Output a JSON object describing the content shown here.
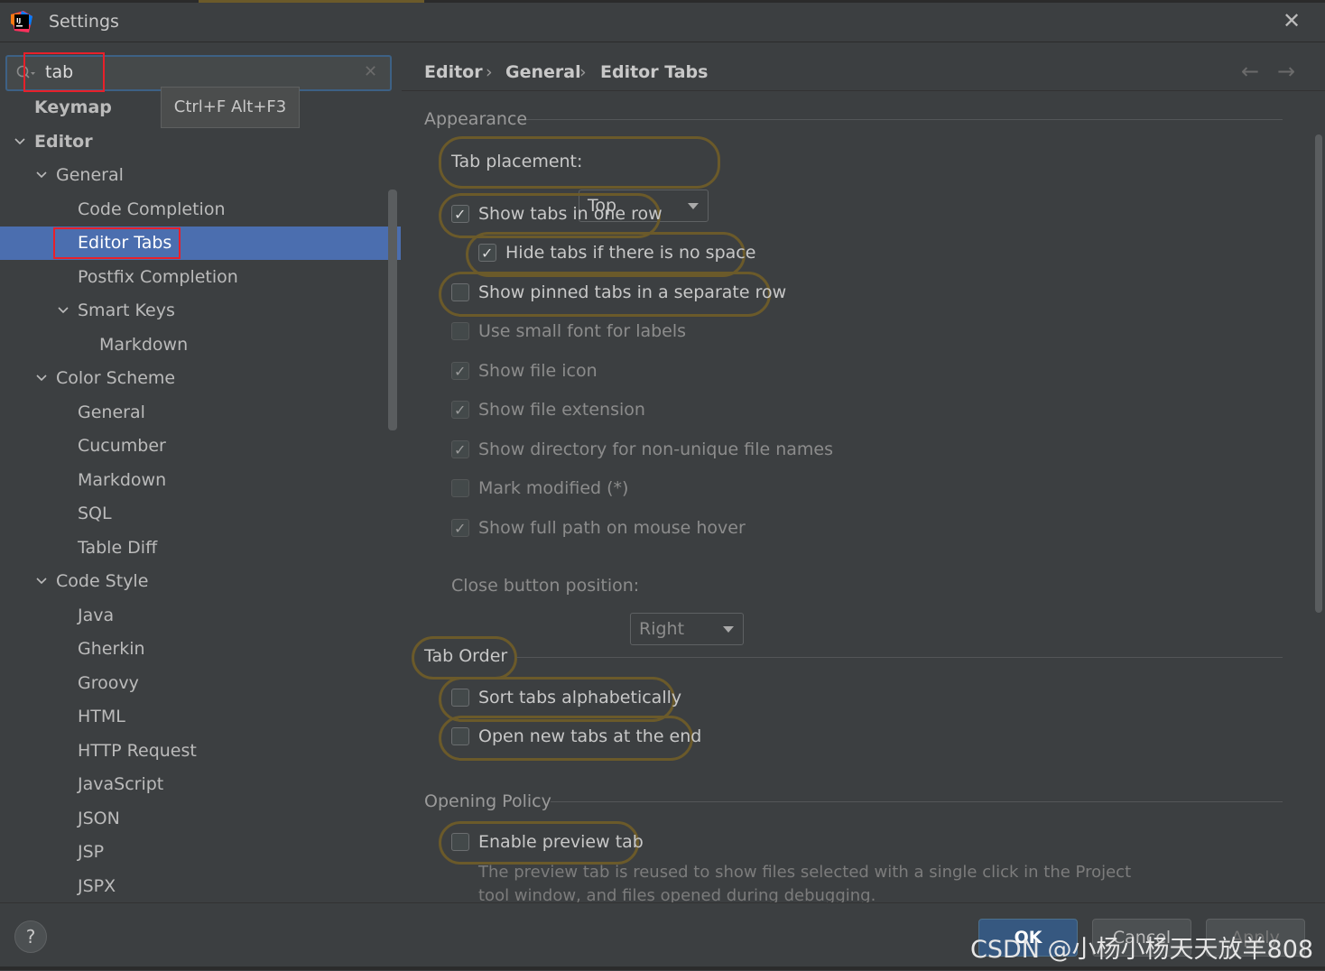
{
  "window": {
    "title": "Settings",
    "close_symbol": "✕"
  },
  "search": {
    "value": "tab",
    "clear_symbol": "✕",
    "tooltip": "Ctrl+F Alt+F3"
  },
  "tree": [
    {
      "label": "Keymap",
      "level": 0,
      "bold": true,
      "chevron": false
    },
    {
      "label": "Editor",
      "level": 0,
      "bold": true,
      "chevron": true
    },
    {
      "label": "General",
      "level": 1,
      "chevron": true
    },
    {
      "label": "Code Completion",
      "level": 2,
      "chevron": false
    },
    {
      "label": "Editor Tabs",
      "level": 2,
      "chevron": false,
      "selected": true
    },
    {
      "label": "Postfix Completion",
      "level": 2,
      "chevron": false
    },
    {
      "label": "Smart Keys",
      "level": 2,
      "chevron": true
    },
    {
      "label": "Markdown",
      "level": 3,
      "chevron": false
    },
    {
      "label": "Color Scheme",
      "level": 1,
      "chevron": true
    },
    {
      "label": "General",
      "level": 2,
      "chevron": false
    },
    {
      "label": "Cucumber",
      "level": 2,
      "chevron": false
    },
    {
      "label": "Markdown",
      "level": 2,
      "chevron": false
    },
    {
      "label": "SQL",
      "level": 2,
      "chevron": false
    },
    {
      "label": "Table Diff",
      "level": 2,
      "chevron": false
    },
    {
      "label": "Code Style",
      "level": 1,
      "chevron": true
    },
    {
      "label": "Java",
      "level": 2,
      "chevron": false
    },
    {
      "label": "Gherkin",
      "level": 2,
      "chevron": false
    },
    {
      "label": "Groovy",
      "level": 2,
      "chevron": false
    },
    {
      "label": "HTML",
      "level": 2,
      "chevron": false
    },
    {
      "label": "HTTP Request",
      "level": 2,
      "chevron": false
    },
    {
      "label": "JavaScript",
      "level": 2,
      "chevron": false
    },
    {
      "label": "JSON",
      "level": 2,
      "chevron": false
    },
    {
      "label": "JSP",
      "level": 2,
      "chevron": false
    },
    {
      "label": "JSPX",
      "level": 2,
      "chevron": false
    }
  ],
  "breadcrumb": {
    "items": [
      "Editor",
      "General",
      "Editor Tabs"
    ],
    "separator": "›",
    "back_symbol": "←",
    "forward_symbol": "→"
  },
  "appearance": {
    "title": "Appearance",
    "tab_placement_label": "Tab placement:",
    "tab_placement_value": "Top",
    "checkboxes": [
      {
        "label": "Show tabs in one row",
        "checked": true,
        "indent": 0,
        "enabled": true,
        "highlighted": true
      },
      {
        "label": "Hide tabs if there is no space",
        "checked": true,
        "indent": 1,
        "enabled": true,
        "highlighted": true
      },
      {
        "label": "Show pinned tabs in a separate row",
        "checked": false,
        "indent": 0,
        "enabled": true,
        "highlighted": true
      },
      {
        "label": "Use small font for labels",
        "checked": false,
        "indent": 0,
        "enabled": false
      },
      {
        "label": "Show file icon",
        "checked": true,
        "indent": 0,
        "enabled": false
      },
      {
        "label": "Show file extension",
        "checked": true,
        "indent": 0,
        "enabled": false
      },
      {
        "label": "Show directory for non-unique file names",
        "checked": true,
        "indent": 0,
        "enabled": false
      },
      {
        "label": "Mark modified (*)",
        "checked": false,
        "indent": 0,
        "enabled": false
      },
      {
        "label": "Show full path on mouse hover",
        "checked": true,
        "indent": 0,
        "enabled": false
      }
    ],
    "close_button_label": "Close button position:",
    "close_button_value": "Right"
  },
  "tab_order": {
    "title": "Tab Order",
    "checkboxes": [
      {
        "label": "Sort tabs alphabetically",
        "checked": false
      },
      {
        "label": "Open new tabs at the end",
        "checked": false
      }
    ]
  },
  "opening_policy": {
    "title": "Opening Policy",
    "preview_label": "Enable preview tab",
    "preview_checked": false,
    "description": "The preview tab is reused to show files selected with a single click in the Project tool window, and files opened during debugging."
  },
  "buttons": {
    "help": "?",
    "ok": "OK",
    "cancel": "Cancel",
    "apply": "Apply"
  },
  "watermark": "CSDN @小杨小杨天天放羊808",
  "colors": {
    "background": "#3c3f41",
    "selection": "#4b6eaf",
    "highlight_ring": "#6b5a2a",
    "red_box": "#e8202a",
    "ok_button": "#365880"
  }
}
